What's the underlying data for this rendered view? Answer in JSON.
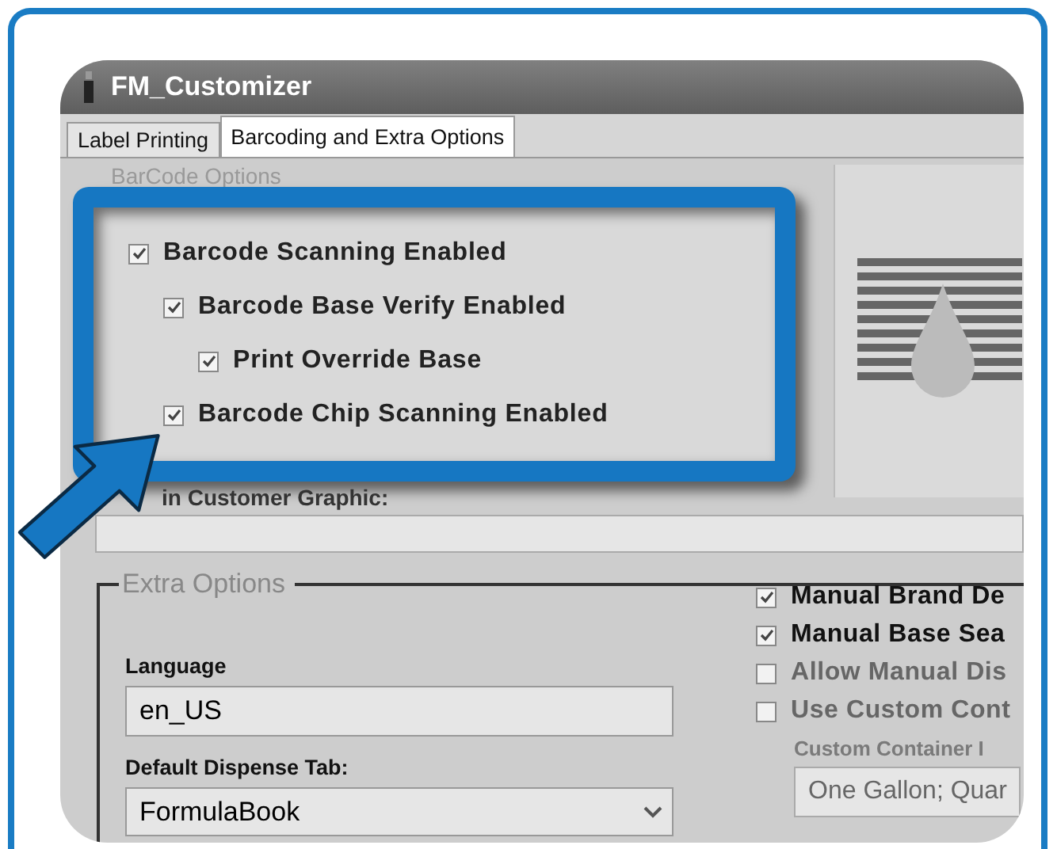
{
  "window": {
    "title": "FM_Customizer"
  },
  "tabs": [
    {
      "label": "Label Printing",
      "selected": false
    },
    {
      "label": "Barcoding and Extra Options",
      "selected": true
    }
  ],
  "barcode_options": {
    "legend": "BarCode Options",
    "checkboxes": [
      {
        "label": "Barcode Scanning Enabled",
        "checked": true,
        "children": [
          {
            "label": "Barcode Base Verify Enabled",
            "checked": true,
            "children": [
              {
                "label": "Print Override Base",
                "checked": true
              }
            ]
          },
          {
            "label": "Barcode Chip Scanning Enabled",
            "checked": true
          }
        ]
      }
    ]
  },
  "customer_graphic": {
    "label": "in Customer Graphic:"
  },
  "extra_options": {
    "legend": "Extra Options",
    "language": {
      "label": "Language",
      "value": "en_US"
    },
    "default_dispense_tab": {
      "label": "Default Dispense Tab:",
      "value": "FormulaBook"
    },
    "checkboxes": [
      {
        "label": "Manual Brand De",
        "checked": true,
        "disabled": false
      },
      {
        "label": "Manual Base Sea",
        "checked": true,
        "disabled": false
      },
      {
        "label": "Allow Manual Dis",
        "checked": false,
        "disabled": true
      },
      {
        "label": "Use Custom Cont",
        "checked": false,
        "disabled": true
      }
    ],
    "custom_container": {
      "label": "Custom Container I",
      "value": "One Gallon; Quar",
      "disabled": true
    }
  }
}
